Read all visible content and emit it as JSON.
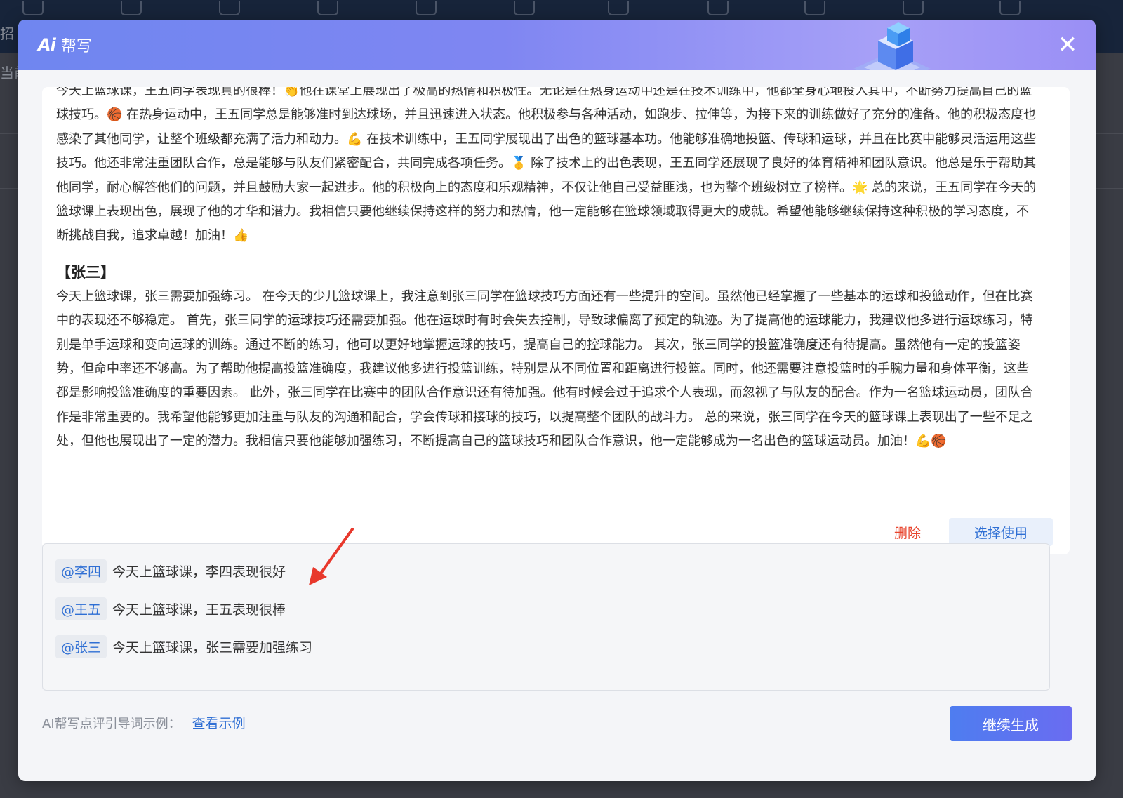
{
  "background": {
    "side_labels": [
      "招",
      "当前"
    ]
  },
  "modal": {
    "logo_text": "Ai",
    "title": "帮写",
    "close_label": "✕"
  },
  "result": {
    "paragraph_wangwu": "今天上篮球课，王五同学表现真的很棒！👏他在课堂上展现出了极高的热情和积极性。无论是在热身运动中还是在技术训练中，他都全身心地投入其中，不断努力提高自己的篮球技巧。🏀 在热身运动中，王五同学总是能够准时到达球场，并且迅速进入状态。他积极参与各种活动，如跑步、拉伸等，为接下来的训练做好了充分的准备。他的积极态度也感染了其他同学，让整个班级都充满了活力和动力。💪 在技术训练中，王五同学展现出了出色的篮球基本功。他能够准确地投篮、传球和运球，并且在比赛中能够灵活运用这些技巧。他还非常注重团队合作，总是能够与队友们紧密配合，共同完成各项任务。🥇 除了技术上的出色表现，王五同学还展现了良好的体育精神和团队意识。他总是乐于帮助其他同学，耐心解答他们的问题，并且鼓励大家一起进步。他的积极向上的态度和乐观精神，不仅让他自己受益匪浅，也为整个班级树立了榜样。🌟 总的来说，王五同学在今天的篮球课上表现出色，展现了他的才华和潜力。我相信只要他继续保持这样的努力和热情，他一定能够在篮球领域取得更大的成就。希望他能够继续保持这种积极的学习态度，不断挑战自我，追求卓越！加油！👍",
    "heading_zhangsan": "【张三】",
    "paragraph_zhangsan": "今天上篮球课，张三需要加强练习。 在今天的少儿篮球课上，我注意到张三同学在篮球技巧方面还有一些提升的空间。虽然他已经掌握了一些基本的运球和投篮动作，但在比赛中的表现还不够稳定。 首先，张三同学的运球技巧还需要加强。他在运球时有时会失去控制，导致球偏离了预定的轨迹。为了提高他的运球能力，我建议他多进行运球练习，特别是单手运球和变向运球的训练。通过不断的练习，他可以更好地掌握运球的技巧，提高自己的控球能力。 其次，张三同学的投篮准确度还有待提高。虽然他有一定的投篮姿势，但命中率还不够高。为了帮助他提高投篮准确度，我建议他多进行投篮训练，特别是从不同位置和距离进行投篮。同时，他还需要注意投篮时的手腕力量和身体平衡，这些都是影响投篮准确度的重要因素。 此外，张三同学在比赛中的团队合作意识还有待加强。他有时候会过于追求个人表现，而忽视了与队友的配合。作为一名篮球运动员，团队合作是非常重要的。我希望他能够更加注重与队友的沟通和配合，学会传球和接球的技巧，以提高整个团队的战斗力。 总的来说，张三同学在今天的篮球课上表现出了一些不足之处，但他也展现出了一定的潜力。我相信只要他能够加强练习，不断提高自己的篮球技巧和团队合作意识，他一定能够成为一名出色的篮球运动员。加油！💪🏀",
    "delete_label": "删除",
    "use_label": "选择使用"
  },
  "prompts": [
    {
      "mention": "@李四",
      "text": "今天上篮球课，李四表现很好"
    },
    {
      "mention": "@王五",
      "text": "今天上篮球课，王五表现很棒"
    },
    {
      "mention": "@张三",
      "text": "今天上篮球课，张三需要加强练习"
    }
  ],
  "footer": {
    "hint_label": "AI帮写点评引导词示例：",
    "view_example_label": "查看示例",
    "generate_label": "继续生成"
  },
  "colors": {
    "accent": "#2f6fd4",
    "danger": "#e8452e",
    "annotation_arrow": "#e8382c"
  }
}
